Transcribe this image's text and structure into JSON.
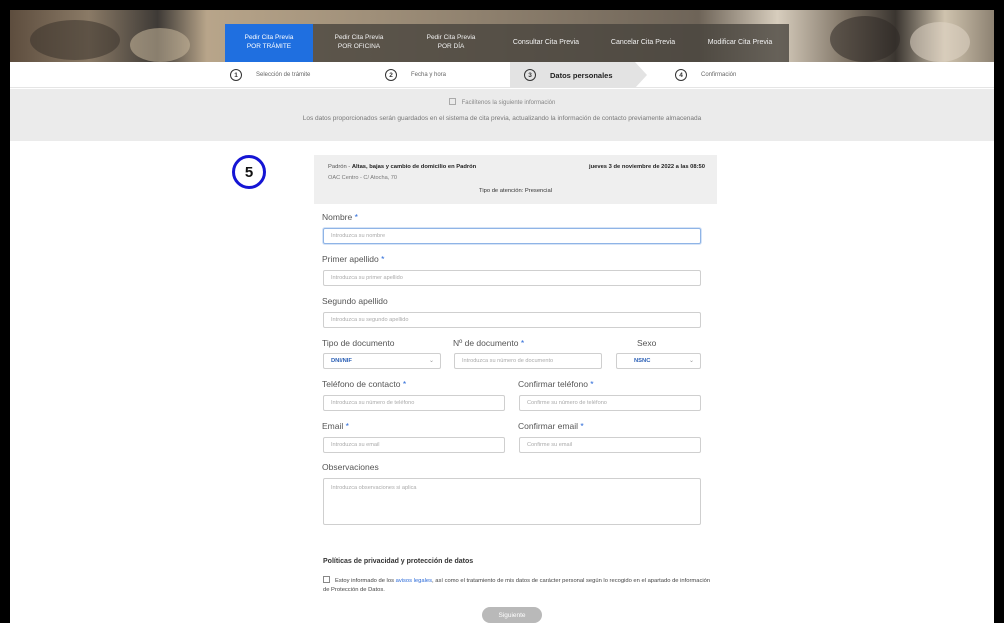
{
  "tabs": [
    {
      "line1": "Pedir Cita Previa",
      "line2": "POR TRÁMITE",
      "active": true
    },
    {
      "line1": "Pedir Cita Previa",
      "line2": "POR OFICINA",
      "active": false
    },
    {
      "line1": "Pedir Cita Previa",
      "line2": "POR DÍA",
      "active": false
    },
    {
      "line1": "Consultar Cita Previa",
      "line2": "",
      "active": false
    },
    {
      "line1": "Cancelar Cita Previa",
      "line2": "",
      "active": false
    },
    {
      "line1": "Modificar Cita Previa",
      "line2": "",
      "active": false
    }
  ],
  "steps": [
    {
      "num": "1",
      "label": "Selección de trámite"
    },
    {
      "num": "2",
      "label": "Fecha y hora"
    },
    {
      "num": "3",
      "label": "Datos personales"
    },
    {
      "num": "4",
      "label": "Confirmación"
    }
  ],
  "info": {
    "checkbox_label": "Facilítenos la siguiente información",
    "notice": "Los datos proporcionados serán guardados en el sistema de cita previa, actualizando la información de contacto previamente almacenada"
  },
  "badge": "5",
  "summary": {
    "service_prefix": "Padrón -",
    "service": "Altas, bajas y cambio de domicilio en Padrón",
    "datetime": "jueves 3 de noviembre de 2022 a las 08:50",
    "office": "OAC Centro - C/ Atocha, 70",
    "attention": "Tipo de atención: Presencial"
  },
  "form": {
    "nombre": {
      "label": "Nombre",
      "placeholder": "Introduzca su nombre"
    },
    "apellido1": {
      "label": "Primer apellido",
      "placeholder": "Introduzca su primer apellido"
    },
    "apellido2": {
      "label": "Segundo apellido",
      "placeholder": "Introduzca su segundo apellido"
    },
    "tipo_doc": {
      "label": "Tipo de documento",
      "value": "DNI/NIF"
    },
    "num_doc": {
      "label": "Nº de documento",
      "placeholder": "Introduzca su número de documento"
    },
    "sexo": {
      "label": "Sexo",
      "value": "NSNC"
    },
    "telefono": {
      "label": "Teléfono de contacto",
      "placeholder": "Introduzca su número de teléfono"
    },
    "confirmar_telefono": {
      "label": "Confirmar teléfono",
      "placeholder": "Confirme su número de teléfono"
    },
    "email": {
      "label": "Email",
      "placeholder": "Introduzca su email"
    },
    "confirmar_email": {
      "label": "Confirmar email",
      "placeholder": "Confirme su email"
    },
    "observaciones": {
      "label": "Observaciones",
      "placeholder": "Introduzca observaciones si aplica"
    },
    "required_mark": "*"
  },
  "privacy": {
    "title": "Políticas de privacidad y protección de datos",
    "text_before": "Estoy informado de los",
    "link": "avisos legales",
    "text_after": ", así como el tratamiento de mis datos de carácter personal según lo recogido en el apartado de información de Protección de Datos."
  },
  "next_button": "Siguiente",
  "colors": {
    "accent": "#1f6fe0",
    "badge_ring": "#1515d4"
  }
}
